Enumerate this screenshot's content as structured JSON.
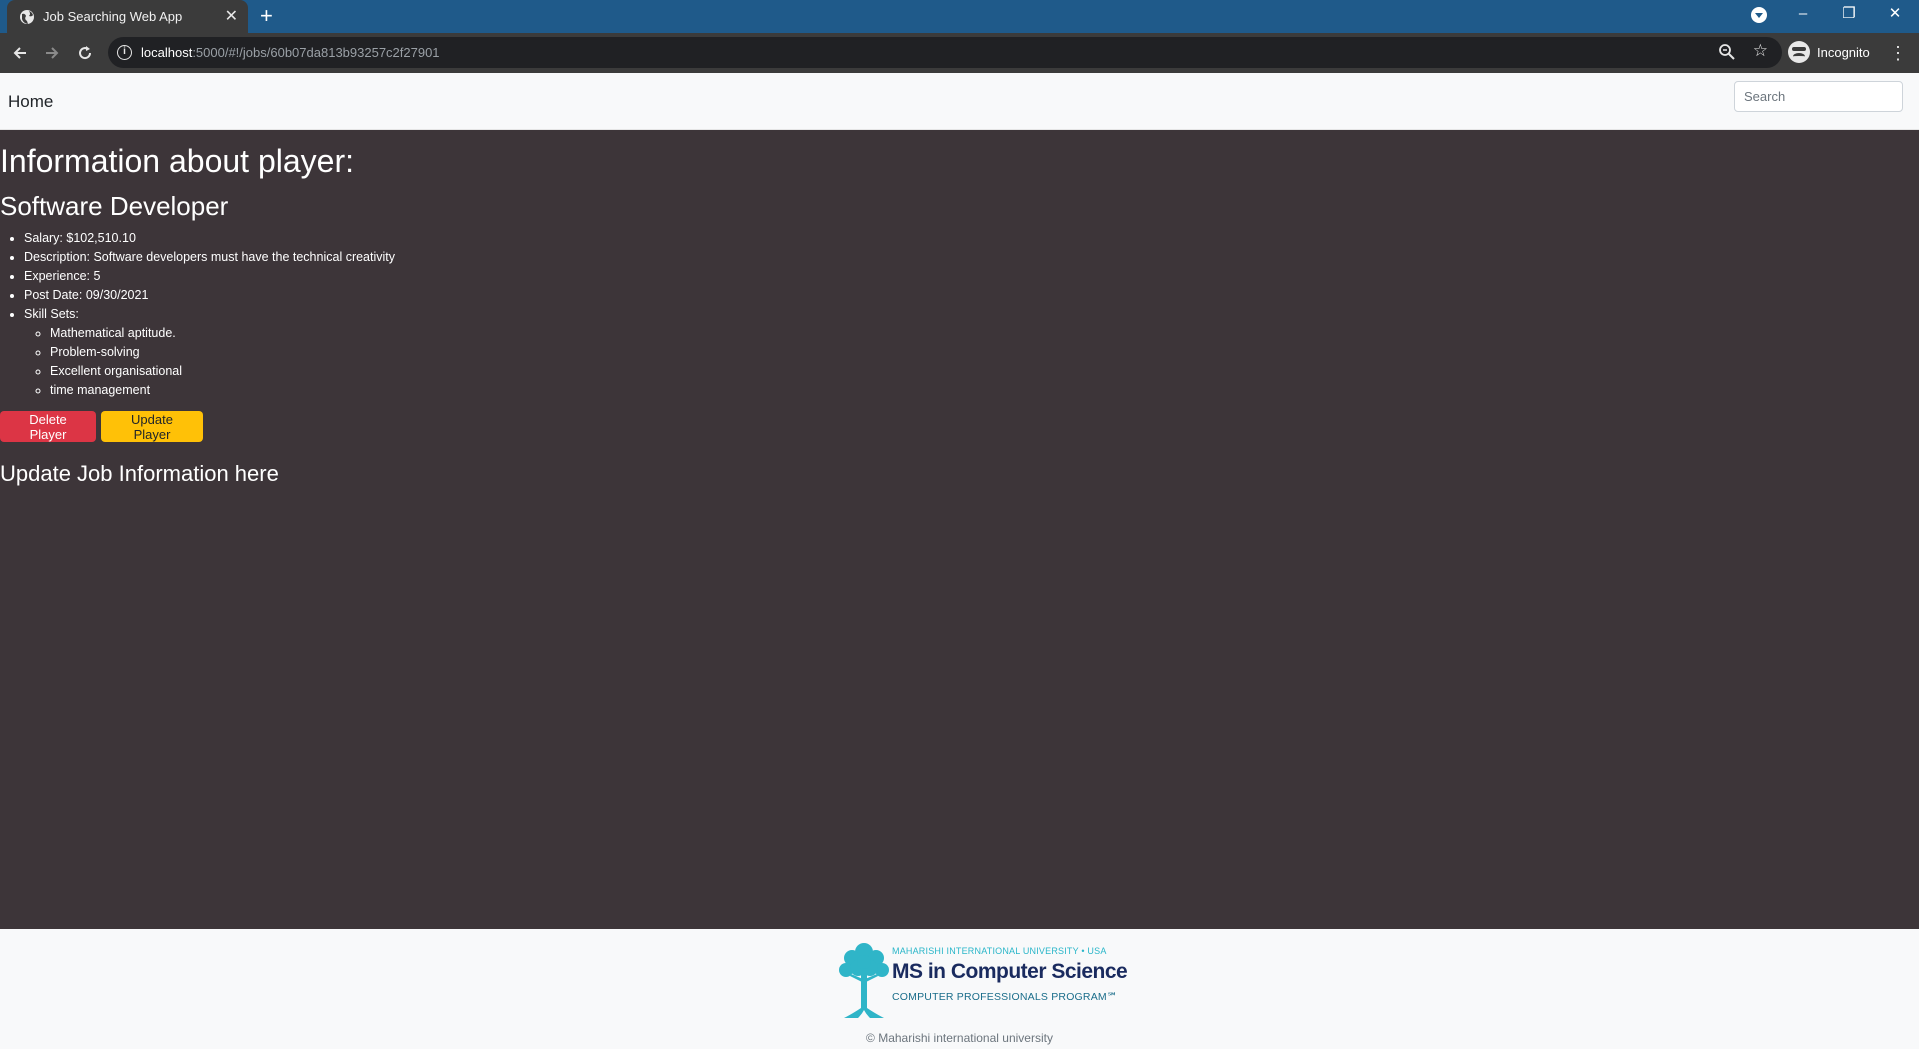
{
  "browser": {
    "tab_title": "Job Searching Web App",
    "tab_close": "✕",
    "new_tab": "+",
    "url_host": "localhost",
    "url_path": ":5000/#!/jobs/60b07da813b93257c2f27901",
    "profile_label": "Incognito",
    "window_minimize": "–",
    "window_restore": "❐",
    "window_close": "✕"
  },
  "navbar": {
    "home_label": "Home",
    "search_placeholder": "Search"
  },
  "main": {
    "heading": "Information about player:",
    "job_title": "Software Developer",
    "details": [
      "Salary: $102,510.10",
      "Description: Software developers must have the technical creativity",
      "Experience: 5",
      "Post Date: 09/30/2021",
      "Skill Sets:"
    ],
    "skills": [
      "Mathematical aptitude.",
      "Problem-solving",
      "Excellent organisational",
      "time management"
    ],
    "delete_button": "Delete Player",
    "update_button": "Update Player",
    "update_heading": "Update Job Information here"
  },
  "footer": {
    "logo_top": "MAHARISHI INTERNATIONAL UNIVERSITY • USA",
    "logo_main": "MS in Computer Science",
    "logo_sub": "COMPUTER PROFESSIONALS PROGRAM℠",
    "copyright": "© Maharishi international university"
  },
  "colors": {
    "tab_strip": "#1f5a8a",
    "page_background": "#3d3539",
    "danger": "#dc3545",
    "warning": "#ffc107"
  }
}
